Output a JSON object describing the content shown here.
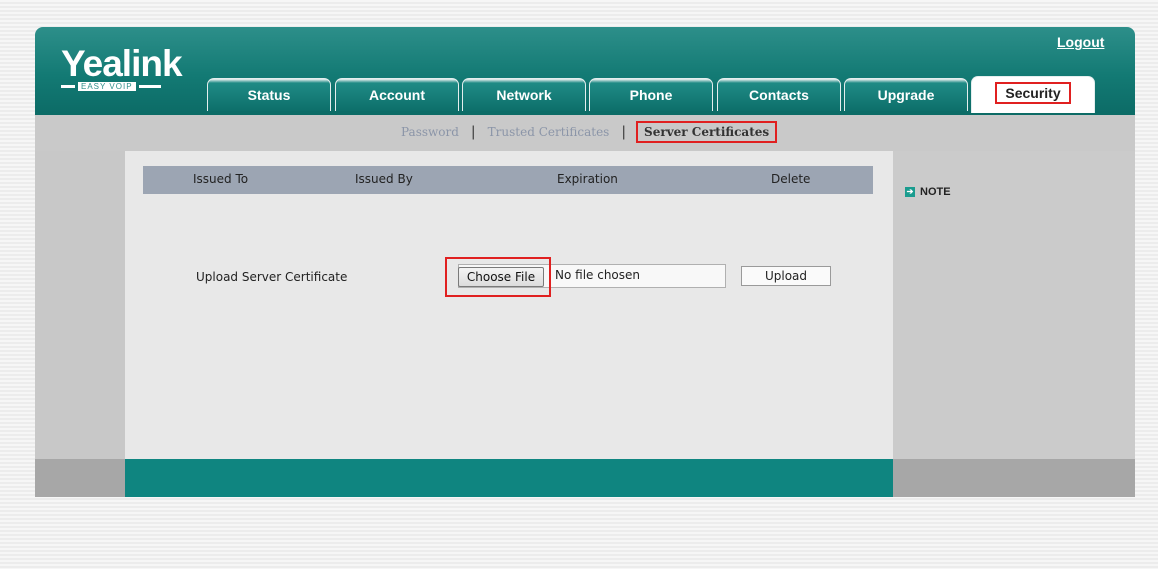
{
  "header": {
    "logo_text": "Yealink",
    "logo_tagline": "EASY VOIP",
    "logout": "Logout"
  },
  "tabs": [
    {
      "label": "Status",
      "active": false
    },
    {
      "label": "Account",
      "active": false
    },
    {
      "label": "Network",
      "active": false
    },
    {
      "label": "Phone",
      "active": false
    },
    {
      "label": "Contacts",
      "active": false
    },
    {
      "label": "Upgrade",
      "active": false
    },
    {
      "label": "Security",
      "active": true
    }
  ],
  "subnav": {
    "items": [
      "Password",
      "Trusted Certificates",
      "Server Certificates"
    ],
    "separator": "|",
    "current": "Server Certificates"
  },
  "table": {
    "headers": [
      "Issued To",
      "Issued By",
      "Expiration",
      "Delete"
    ]
  },
  "upload": {
    "label": "Upload Server Certificate",
    "choose_file": "Choose File",
    "no_file": "No file chosen",
    "upload_button": "Upload"
  },
  "side": {
    "note_label": "NOTE",
    "note_icon": "arrow-right-icon"
  },
  "colors": {
    "brand_teal": "#137a74",
    "highlight_red": "#e02020",
    "subnav_link": "#8b95a8"
  }
}
